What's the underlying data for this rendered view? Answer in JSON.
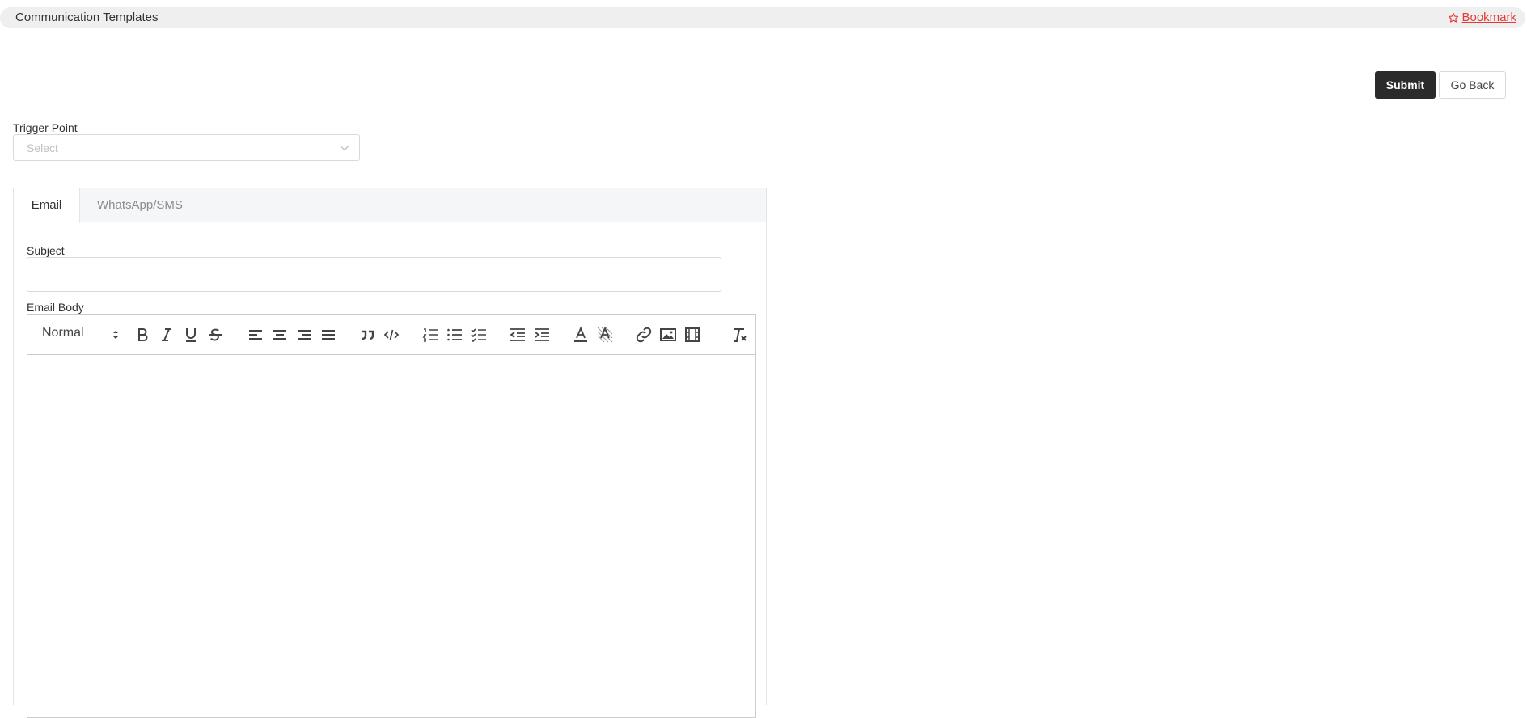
{
  "header": {
    "title": "Communication Templates",
    "bookmark_label": " Bookmark"
  },
  "actions": {
    "submit_label": "Submit",
    "goback_label": "Go Back"
  },
  "trigger_point": {
    "label": "Trigger Point",
    "placeholder": "Select"
  },
  "tabs": [
    {
      "label": "Email",
      "active": true
    },
    {
      "label": "WhatsApp/SMS",
      "active": false
    }
  ],
  "email": {
    "subject_label": "Subject",
    "subject_value": "",
    "body_label": "Email Body",
    "format_value": "Normal"
  },
  "toolbar_icons": [
    "bold-icon",
    "italic-icon",
    "underline-icon",
    "strikethrough-icon",
    "align-left-icon",
    "align-center-icon",
    "align-right-icon",
    "align-justify-icon",
    "blockquote-icon",
    "code-block-icon",
    "ordered-list-icon",
    "bullet-list-icon",
    "checklist-icon",
    "outdent-icon",
    "indent-icon",
    "text-color-icon",
    "background-color-icon",
    "link-icon",
    "image-icon",
    "video-icon",
    "clear-formatting-icon"
  ],
  "colors": {
    "accent_red": "#e53935",
    "submit_bg": "#2b2b2b",
    "header_bg": "#efefef"
  }
}
